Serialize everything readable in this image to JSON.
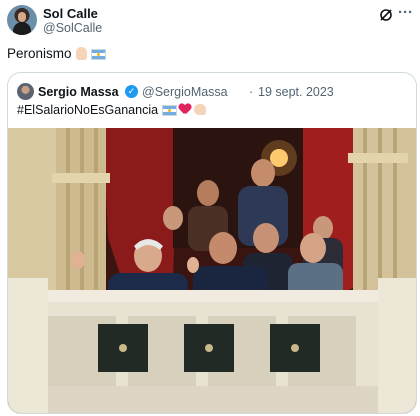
{
  "tweet": {
    "author_name": "Sol Calle",
    "author_handle": "@SolCalle",
    "text": "Peronismo"
  },
  "quoted": {
    "author_name": "Sergio Massa",
    "author_handle": "@SergioMassa",
    "separator": "·",
    "date": "19 sept. 2023",
    "text": "#ElSalarioNoEsGanancia"
  },
  "icons": {
    "grok": "grok-icon",
    "more": "more-icon",
    "verified": "verified-badge-icon",
    "raised_hand": "raised-hand-emoji",
    "flag": "argentina-flag-emoji",
    "heart": "red-heart-emoji",
    "bicep": "flexed-biceps-emoji"
  },
  "colors": {
    "text": "#0f1419",
    "secondary_text": "#536471",
    "border": "#cfd9de",
    "verified_blue": "#1d9bf0",
    "heart_red": "#e0245e"
  }
}
